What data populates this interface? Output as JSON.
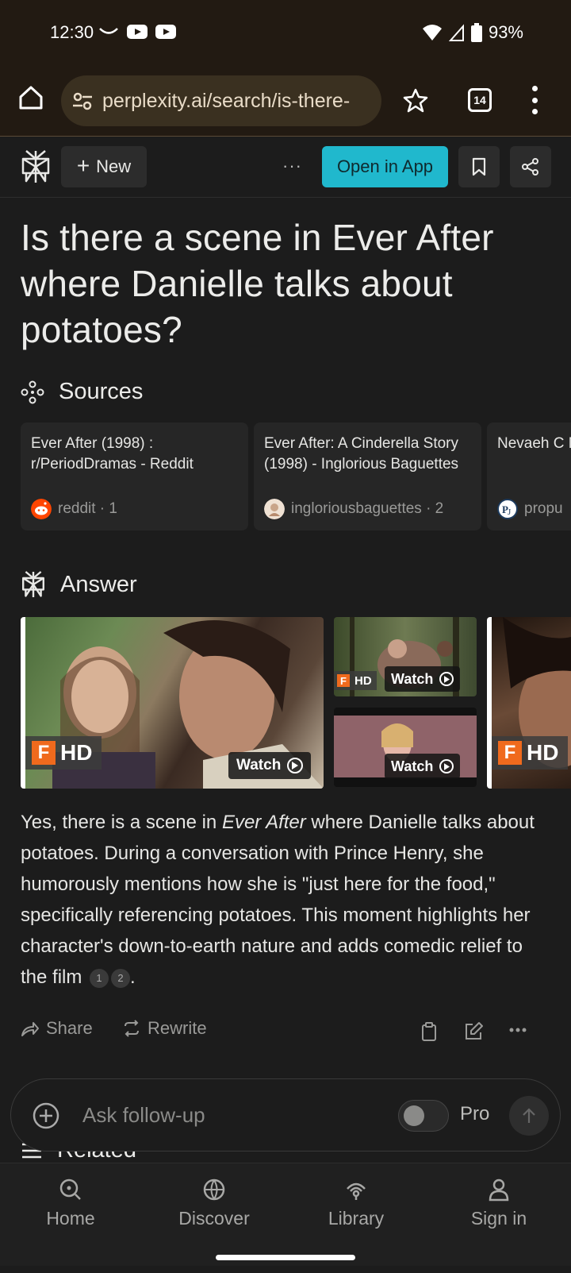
{
  "status_bar": {
    "time": "12:30",
    "battery": "93%"
  },
  "browser": {
    "url": "perplexity.ai/search/is-there-",
    "tab_count": "14"
  },
  "header": {
    "new_label": "New",
    "more_label": "···",
    "open_app_label": "Open in App"
  },
  "question": "Is there a scene in Ever After where Danielle talks about potatoes?",
  "sources": {
    "heading": "Sources",
    "items": [
      {
        "title": "Ever After (1998) : r/PeriodDramas - Reddit",
        "site": "reddit · 1",
        "favicon": "reddit-icon",
        "color": "#ff4500"
      },
      {
        "title": "Ever After: A Cinderella Story (1998) - Inglorious Baguettes",
        "site": "ingloriousbaguettes · 2",
        "favicon": "inglorious-baguettes-icon",
        "color": "#e8d2c0"
      },
      {
        "title": "Nevaeh C Miscarria Get Care",
        "site": "propu",
        "favicon": "propublica-icon",
        "color": "#1d3b5e"
      }
    ]
  },
  "answer": {
    "heading": "Answer",
    "media": [
      {
        "badge": "HD",
        "watch_label": "Watch"
      },
      {
        "badge": "HD",
        "watch_label": "Watch"
      },
      {
        "badge": "",
        "watch_label": "Watch"
      },
      {
        "badge": "HD",
        "watch_label": ""
      }
    ],
    "text_part1": "Yes, there is a scene in ",
    "text_em": "Ever After",
    "text_part2": " where Danielle talks about potatoes. During a conversation with Prince Henry, she humorously mentions how she is \"just here for the food,\" specifically referencing potatoes. This moment highlights her character's down-to-earth nature and adds comedic relief to the film",
    "citations": [
      "1",
      "2"
    ],
    "text_end": "."
  },
  "actions": {
    "share_label": "Share",
    "rewrite_label": "Rewrite"
  },
  "related_heading": "Related",
  "followup": {
    "placeholder": "Ask follow-up",
    "pro_label": "Pro"
  },
  "bottom_nav": [
    {
      "label": "Home",
      "icon": "search-home-icon"
    },
    {
      "label": "Discover",
      "icon": "globe-icon"
    },
    {
      "label": "Library",
      "icon": "library-icon"
    },
    {
      "label": "Sign in",
      "icon": "person-icon"
    }
  ],
  "colors": {
    "accent": "#20b8cd",
    "background": "#1c1c1c",
    "browser_chrome": "#221a12"
  }
}
